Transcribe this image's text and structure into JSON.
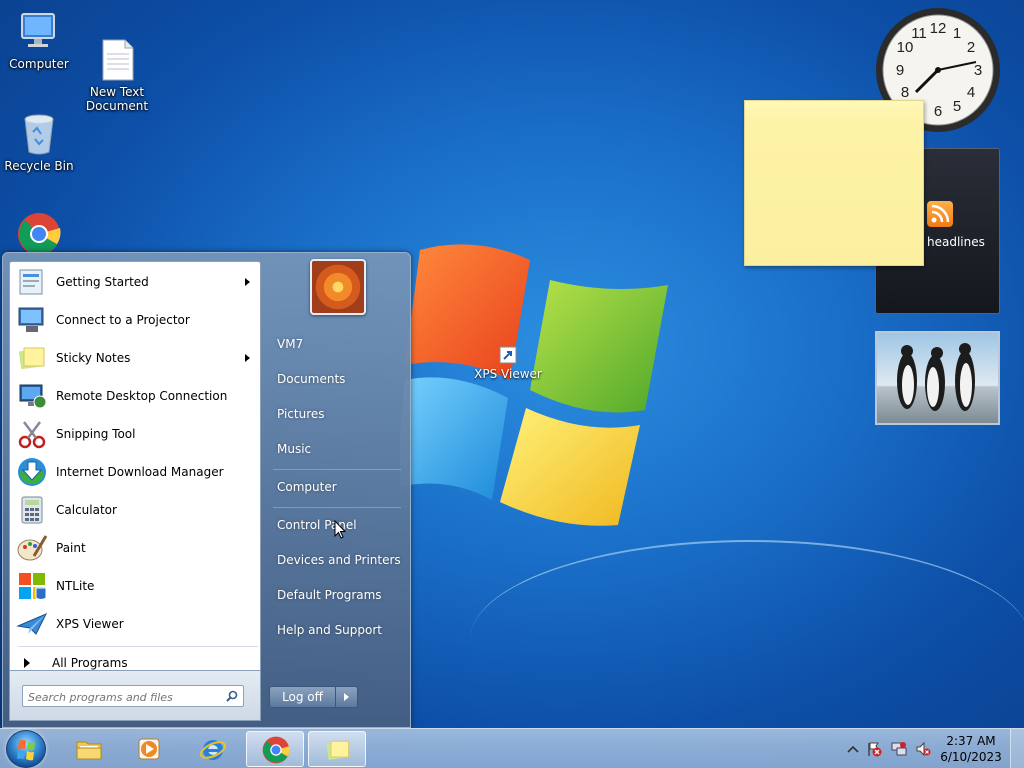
{
  "desktop": {
    "icons": [
      {
        "label": "Computer"
      },
      {
        "label": "New Text\nDocument"
      },
      {
        "label": "Recycle Bin"
      }
    ],
    "xps_label": "XPS Viewer"
  },
  "gadgets": {
    "clock_numbers": [
      "12",
      "1",
      "2",
      "3",
      "4",
      "5",
      "6",
      "7",
      "8",
      "9",
      "10",
      "11"
    ],
    "feed_text": "headlines"
  },
  "start_menu": {
    "programs": [
      {
        "label": "Getting Started",
        "submenu": true,
        "icon": "getting-started-icon"
      },
      {
        "label": "Connect to a Projector",
        "submenu": false,
        "icon": "projector-icon"
      },
      {
        "label": "Sticky Notes",
        "submenu": true,
        "icon": "sticky-notes-icon"
      },
      {
        "label": "Remote Desktop Connection",
        "submenu": false,
        "icon": "remote-desktop-icon"
      },
      {
        "label": "Snipping Tool",
        "submenu": false,
        "icon": "snipping-tool-icon"
      },
      {
        "label": "Internet Download Manager",
        "submenu": false,
        "icon": "idm-icon"
      },
      {
        "label": "Calculator",
        "submenu": false,
        "icon": "calculator-icon"
      },
      {
        "label": "Paint",
        "submenu": false,
        "icon": "paint-icon"
      },
      {
        "label": "NTLite",
        "submenu": false,
        "icon": "ntlite-icon"
      },
      {
        "label": "XPS Viewer",
        "submenu": false,
        "icon": "xps-viewer-icon"
      }
    ],
    "all_programs": "All Programs",
    "search_placeholder": "Search programs and files",
    "right_items": {
      "user": "VM7",
      "documents": "Documents",
      "pictures": "Pictures",
      "music": "Music",
      "computer": "Computer",
      "control_panel": "Control Panel",
      "devices": "Devices and Printers",
      "default_programs": "Default Programs",
      "help": "Help and Support"
    },
    "logoff": "Log off"
  },
  "taskbar": {
    "time": "2:37 AM",
    "date": "6/10/2023"
  }
}
